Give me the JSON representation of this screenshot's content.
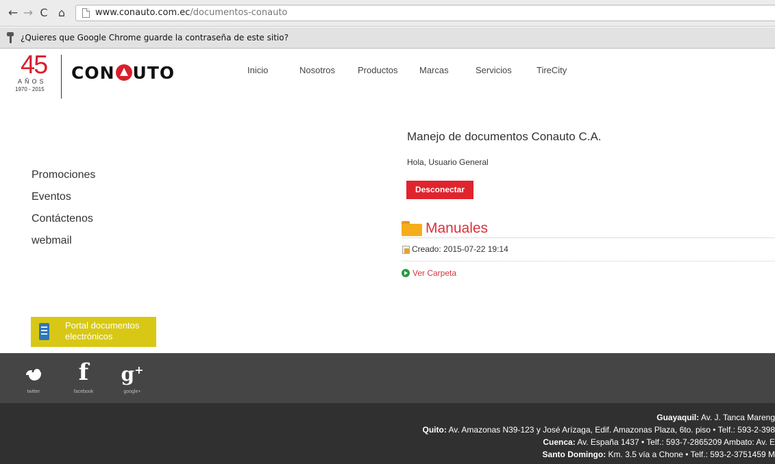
{
  "browser": {
    "url_host": "www.conauto.com.ec",
    "url_path": "/documentos-conauto",
    "password_prompt": "¿Quieres que Google Chrome guarde la contraseña de este sitio?"
  },
  "logo": {
    "number": "45",
    "anos": "AÑOS",
    "years": "1970 - 2015",
    "brand_before": "CON",
    "brand_after": "UTO"
  },
  "topnav": [
    "Inicio",
    "Nosotros",
    "Productos",
    "Marcas",
    "Servicios",
    "TireCity"
  ],
  "sidebar": {
    "links": [
      "Promociones",
      "Eventos",
      "Contáctenos",
      "webmail"
    ],
    "portal_label": "Portal documentos electrónicos"
  },
  "content": {
    "title": "Manejo de documentos Conauto C.A.",
    "greeting": "Hola, Usuario General",
    "logout_label": "Desconectar",
    "folder_title": "Manuales",
    "created": "Creado: 2015-07-22 19:14",
    "view_label": "Ver Carpeta"
  },
  "social": [
    {
      "icon": "twitter-icon",
      "label": "twitter"
    },
    {
      "icon": "facebook-icon",
      "label": "facebook"
    },
    {
      "icon": "google-plus-icon",
      "label": "google+"
    }
  ],
  "footer": {
    "lines": [
      {
        "city": "Guayaquil:",
        "text": " Av. J. Tanca Mareng"
      },
      {
        "city": "Quito:",
        "text": " Av. Amazonas N39-123 y José Arízaga, Edif. Amazonas Plaza, 6to. piso • Telf.: 593-2-398"
      },
      {
        "city": "Cuenca:",
        "text": " Av. España 1437 • Telf.: 593-7-2865209  Ambato: Av. E"
      },
      {
        "city": "Santo Domingo:",
        "text": " Km. 3.5 vía a Chone • Telf.: 593-2-3751459  M"
      }
    ]
  },
  "colors": {
    "accent_red": "#d8323c",
    "button_red": "#e0242e",
    "portal_yellow": "#d8c815",
    "social_bg": "#454545",
    "footer_bg": "#303030"
  }
}
